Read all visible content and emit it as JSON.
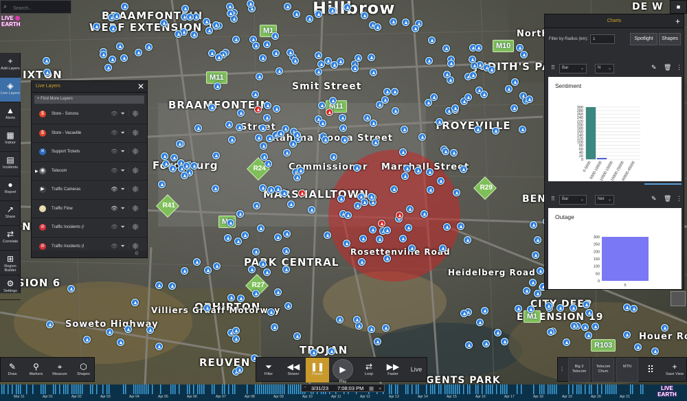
{
  "search": {
    "placeholder": "Search..."
  },
  "logo": {
    "line1": "LIVE",
    "line2": "EARTH"
  },
  "map_labels": [
    {
      "text": "BRAAMFONTEIN",
      "x": 148,
      "y": 14,
      "size": 15
    },
    {
      "text": "WERF EXTENSION 1",
      "x": 130,
      "y": 31,
      "size": 15
    },
    {
      "text": "Hillbrow",
      "x": 455,
      "y": -2,
      "size": 24
    },
    {
      "text": "DE W",
      "x": 920,
      "y": 2,
      "size": 14
    },
    {
      "text": "IXTON",
      "x": 33,
      "y": 100,
      "size": 15
    },
    {
      "text": "JUDITH'S PA",
      "x": 690,
      "y": 88,
      "size": 15
    },
    {
      "text": "Smit Street",
      "x": 425,
      "y": 118,
      "size": 14
    },
    {
      "text": "BRAAMFONTEIN",
      "x": 245,
      "y": 144,
      "size": 15
    },
    {
      "text": "TROYEVILLE",
      "x": 632,
      "y": 174,
      "size": 15
    },
    {
      "text": "Street",
      "x": 350,
      "y": 178,
      "size": 13
    },
    {
      "text": "Rahima Moosa Street",
      "x": 396,
      "y": 194,
      "size": 13
    },
    {
      "text": "Fordsburg",
      "x": 222,
      "y": 232,
      "size": 15
    },
    {
      "text": "Marshall Street",
      "x": 555,
      "y": 236,
      "size": 13
    },
    {
      "text": "MARSHALLTOWN",
      "x": 383,
      "y": 274,
      "size": 15
    },
    {
      "text": "BEN",
      "x": 760,
      "y": 282,
      "size": 14
    },
    {
      "text": "SION 24",
      "x": 0,
      "y": 321,
      "size": 15
    },
    {
      "text": "PARK CENTRAL",
      "x": 355,
      "y": 373,
      "size": 15
    },
    {
      "text": "ENSION 6",
      "x": 0,
      "y": 403,
      "size": 15
    },
    {
      "text": "OPHIRTON",
      "x": 283,
      "y": 438,
      "size": 15
    },
    {
      "text": "CITY DEEP",
      "x": 772,
      "y": 435,
      "size": 14
    },
    {
      "text": "EXTENSION 19",
      "x": 752,
      "y": 454,
      "size": 14
    },
    {
      "text": "Soweto Highway",
      "x": 95,
      "y": 465,
      "size": 13
    },
    {
      "text": "TROJAN",
      "x": 436,
      "y": 501,
      "size": 15
    },
    {
      "text": "Houer Roa",
      "x": 930,
      "y": 483,
      "size": 13
    },
    {
      "text": "REUVEN",
      "x": 290,
      "y": 519,
      "size": 15
    },
    {
      "text": "GENTS PARK",
      "x": 620,
      "y": 546,
      "size": 14
    },
    {
      "text": "Rosettenville Road",
      "x": 510,
      "y": 360,
      "size": 12
    },
    {
      "text": "Villiers Graaff Motorway",
      "x": 220,
      "y": 445,
      "size": 12
    },
    {
      "text": "Heidelberg Road",
      "x": 652,
      "y": 390,
      "size": 12
    },
    {
      "text": "Commissioner",
      "x": 420,
      "y": 236,
      "size": 13
    },
    {
      "text": "North",
      "x": 752,
      "y": 42,
      "size": 13
    }
  ],
  "road_shields": [
    {
      "text": "M11",
      "x": 300,
      "y": 104
    },
    {
      "text": "M11",
      "x": 474,
      "y": 146
    },
    {
      "text": "M10",
      "x": 717,
      "y": 58
    },
    {
      "text": "M1",
      "x": 378,
      "y": 36
    },
    {
      "text": "M1",
      "x": 318,
      "y": 314
    },
    {
      "text": "M1",
      "x": 762,
      "y": 452
    },
    {
      "text": "R103",
      "x": 860,
      "y": 494
    }
  ],
  "diamonds": [
    {
      "text": "R24",
      "x": 364,
      "y": 234
    },
    {
      "text": "R29",
      "x": 694,
      "y": 262
    },
    {
      "text": "R41",
      "x": 232,
      "y": 288
    },
    {
      "text": "R27",
      "x": 362,
      "y": 404
    }
  ],
  "left_toolbar": [
    {
      "name": "add-layers",
      "label": "Add Layers",
      "icon": "+"
    },
    {
      "name": "live-layers",
      "label": "Live Layers",
      "icon": "◈",
      "active": true
    },
    {
      "name": "alerts",
      "label": "Alerts",
      "icon": "▲"
    },
    {
      "name": "indoor",
      "label": "Indoor",
      "icon": "▦"
    },
    {
      "name": "incidents",
      "label": "Incidents",
      "icon": "▤"
    },
    {
      "name": "report",
      "label": "Report",
      "icon": "●"
    },
    {
      "name": "share",
      "label": "Share",
      "icon": "↗"
    },
    {
      "name": "correlate",
      "label": "Correlate",
      "icon": "⇄"
    },
    {
      "name": "region-builder",
      "label": "Region Builder",
      "icon": "⊞"
    },
    {
      "name": "settings",
      "label": "Settings",
      "icon": "⚙"
    }
  ],
  "live_layers": {
    "title": "Live Layers",
    "find_more": "+ Find More Layers",
    "rows": [
      {
        "name": "Store - Sonora",
        "icon": "$",
        "color": "#e0452a",
        "eye": false
      },
      {
        "name": "Store - Vacaville",
        "icon": "$",
        "color": "#e0452a",
        "eye": false
      },
      {
        "name": "Support Tickets",
        "icon": "✕",
        "color": "#2d6cc0",
        "eye": false
      },
      {
        "name": "Telecom",
        "icon": "◉",
        "color": "#666666",
        "eye": false,
        "expandable": true
      },
      {
        "name": "Traffic Cameras",
        "icon": "▶",
        "color": "#444444",
        "eye": true
      },
      {
        "name": "Traffic Flow",
        "icon": "/",
        "color": "#e6d9a8",
        "eye": true
      },
      {
        "name": "Traffic Incidents (/",
        "icon": "⊘",
        "color": "#d0303a",
        "eye": false
      },
      {
        "name": "Traffic Incidents (I",
        "icon": "⊘",
        "color": "#d0303a",
        "eye": false
      }
    ]
  },
  "charts_panel": {
    "title": "Charts",
    "filter_label": "Filter by Radius (km):",
    "filter_value": "1",
    "spotlight_label": "Spotlight",
    "shapes_label": "Shapes",
    "chart1_type": "Bar",
    "chart1_field": "N",
    "chart2_type": "Bar",
    "chart2_field": "Net"
  },
  "chart_data": [
    {
      "type": "bar",
      "title": "Sentiment",
      "categories": [
        "0-5000",
        "5000-10000",
        "10000-15000",
        "15000-25000",
        "40000-45000"
      ],
      "values": [
        308,
        8,
        0,
        0,
        0
      ],
      "ylim": [
        0,
        300
      ],
      "yticks": [
        0,
        20,
        40,
        60,
        80,
        100,
        120,
        140,
        160,
        180,
        200,
        220,
        240,
        260,
        280,
        300
      ],
      "grid": true,
      "colors": [
        "#3c8780",
        "#4d5fd0",
        "#3c8780",
        "#3c8780",
        "#3c8780"
      ]
    },
    {
      "type": "bar",
      "title": "Outage",
      "categories": [
        "5"
      ],
      "values": [
        318
      ],
      "ylim": [
        0,
        300
      ],
      "yticks": [
        0,
        50,
        100,
        150,
        200,
        250,
        300
      ],
      "grid": true,
      "colors": [
        "#7a78f5"
      ]
    }
  ],
  "bottom_left": [
    {
      "name": "draw",
      "label": "Draw",
      "icon": "✎"
    },
    {
      "name": "markers",
      "label": "Markers",
      "icon": "⚲"
    },
    {
      "name": "measure",
      "label": "Measure",
      "icon": "⌖"
    },
    {
      "name": "shapes",
      "label": "Shapes",
      "icon": "⬡"
    }
  ],
  "playback": {
    "filter": "Filter",
    "slower": "Slower",
    "pause": "Pause",
    "play": "Play",
    "loop": "Loop",
    "faster": "Faster",
    "live": "Live"
  },
  "bottom_right": {
    "big3": "Big 3 Telecom",
    "churn": "Telecom Churn",
    "mtn": "MTN",
    "save_view": "Save View"
  },
  "timeline": {
    "date": "3/31/23",
    "time": "7:08:03 PM",
    "labels": [
      "Mar 31",
      "Apr 01",
      "Apr 02",
      "Apr 03",
      "Apr 04",
      "Apr 05",
      "Apr 06",
      "Apr 07",
      "Apr 08",
      "Apr 09",
      "Apr 10",
      "Apr 11",
      "Apr 12",
      "Apr 13",
      "Apr 14",
      "Apr 15",
      "Apr 16",
      "Apr 17",
      "Apr 18",
      "Apr 19",
      "Apr 20",
      "Apr 21"
    ]
  },
  "colors": {
    "accent": "#d7a529",
    "active_tool": "#3d6fa8",
    "marker": "#2f7de0",
    "alert_marker": "#e02020"
  }
}
